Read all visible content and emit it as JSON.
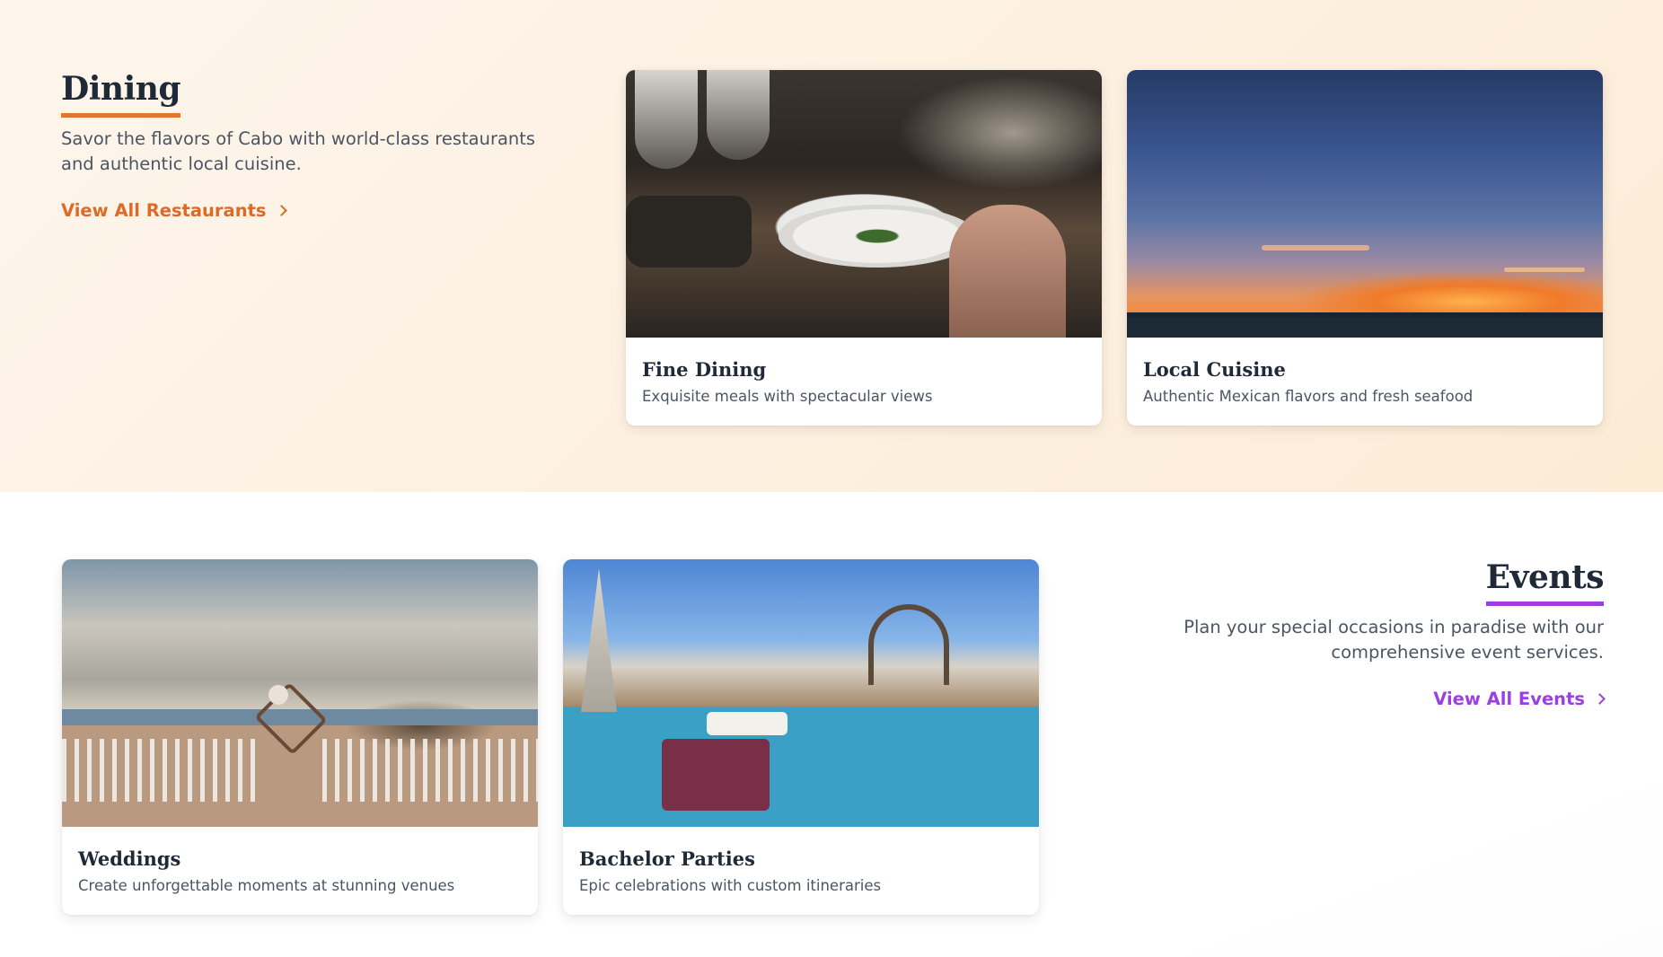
{
  "dining": {
    "title": "Dining",
    "description": "Savor the flavors of Cabo with world-class restaurants and authentic local cuisine.",
    "link_label": "View All Restaurants",
    "accent_color": "#dd6a25",
    "cards": [
      {
        "title": "Fine Dining",
        "subtitle": "Exquisite meals with spectacular views",
        "image": "plated-dish-on-dining-table-photo"
      },
      {
        "title": "Local Cuisine",
        "subtitle": "Authentic Mexican flavors and fresh seafood",
        "image": "ocean-sunset-photo"
      }
    ]
  },
  "events": {
    "title": "Events",
    "description": "Plan your special occasions in paradise with our comprehensive event services.",
    "link_label": "View All Events",
    "accent_color": "#9b3fe0",
    "cards": [
      {
        "title": "Weddings",
        "subtitle": "Create unforgettable moments at stunning venues",
        "image": "beach-wedding-ceremony-photo"
      },
      {
        "title": "Bachelor Parties",
        "subtitle": "Epic celebrations with custom itineraries",
        "image": "pool-party-photo"
      }
    ]
  },
  "icons": {
    "link_arrow": "chevron-right-icon"
  }
}
